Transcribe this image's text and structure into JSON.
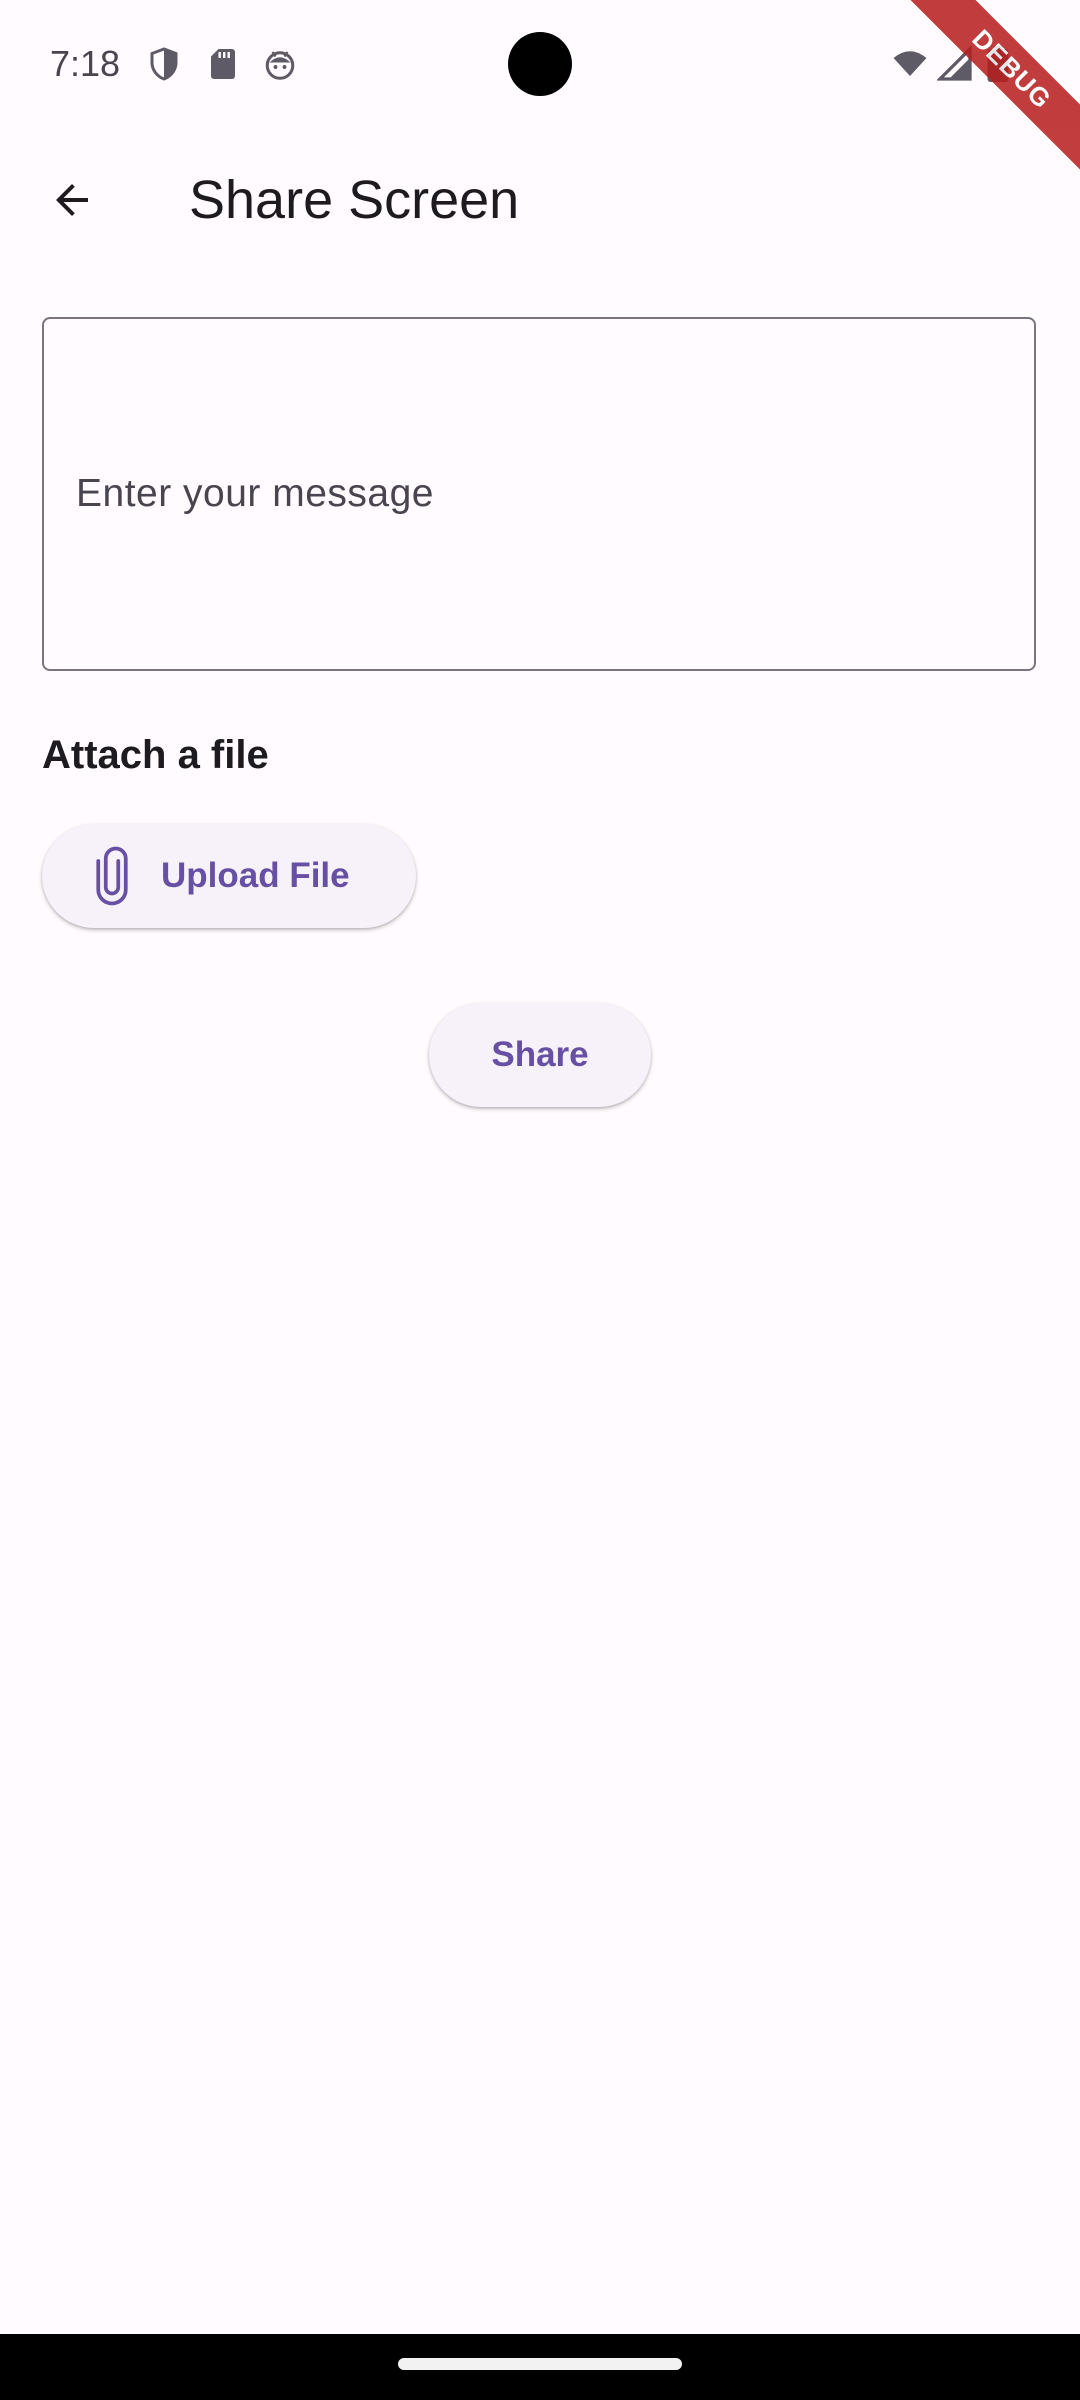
{
  "status_bar": {
    "time": "7:18",
    "left_icons": [
      "shield-icon",
      "sd-card-icon",
      "android-face-icon"
    ],
    "right_icons": [
      "wifi-icon",
      "signal-icon",
      "battery-icon"
    ]
  },
  "debug_banner": {
    "label": "DEBUG"
  },
  "app_bar": {
    "back_icon": "arrow-back-icon",
    "title": "Share Screen"
  },
  "message_field": {
    "placeholder": "Enter your message",
    "value": ""
  },
  "attach_section": {
    "label": "Attach a file"
  },
  "buttons": {
    "upload_label": "Upload File",
    "upload_icon": "paperclip-icon",
    "share_label": "Share"
  },
  "colors": {
    "background": "#fffbfe",
    "primary": "#6750a4",
    "button_surface": "#f7f2fa",
    "outline": "#79747e",
    "debug_red": "#b71c1c"
  }
}
